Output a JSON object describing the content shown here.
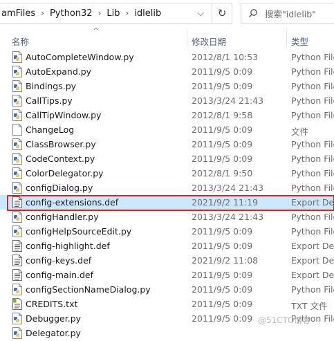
{
  "address": {
    "crumbs": [
      "amFiles",
      "Python32",
      "Lib",
      "idlelib"
    ],
    "separator": "›",
    "dropdown_icon": "chevron-down-icon",
    "refresh_icon": "refresh-icon"
  },
  "search": {
    "placeholder": "搜索\"idlelib\"",
    "icon": "search-icon"
  },
  "columns": {
    "name": "名称",
    "date": "修改日期",
    "type": "类型"
  },
  "files": [
    {
      "name": "AutoCompleteWindow.py",
      "date": "2012/8/1 10:53",
      "type": "Python File",
      "icon": "python-file-icon"
    },
    {
      "name": "AutoExpand.py",
      "date": "2011/9/5 0:09",
      "type": "Python File",
      "icon": "python-file-icon"
    },
    {
      "name": "Bindings.py",
      "date": "2011/9/5 0:09",
      "type": "Python File",
      "icon": "python-file-icon"
    },
    {
      "name": "CallTips.py",
      "date": "2013/3/24 21:43",
      "type": "Python File",
      "icon": "python-file-icon"
    },
    {
      "name": "CallTipWindow.py",
      "date": "2012/8/1 9:58",
      "type": "Python File",
      "icon": "python-file-icon"
    },
    {
      "name": "ChangeLog",
      "date": "2011/9/5 0:09",
      "type": "文件",
      "icon": "blank-file-icon"
    },
    {
      "name": "ClassBrowser.py",
      "date": "2011/9/5 0:09",
      "type": "Python File",
      "icon": "python-file-icon"
    },
    {
      "name": "CodeContext.py",
      "date": "2011/9/5 0:09",
      "type": "Python File",
      "icon": "python-file-icon"
    },
    {
      "name": "ColorDelegator.py",
      "date": "2012/8/1 9:50",
      "type": "Python File",
      "icon": "python-file-icon"
    },
    {
      "name": "configDialog.py",
      "date": "2013/3/24 21:43",
      "type": "Python File",
      "icon": "python-file-icon"
    },
    {
      "name": "config-extensions.def",
      "date": "2021/9/2 11:19",
      "type": "Export Def",
      "icon": "def-file-icon",
      "selected": true
    },
    {
      "name": "configHandler.py",
      "date": "2013/3/24 21:43",
      "type": "Python File",
      "icon": "python-file-icon"
    },
    {
      "name": "configHelpSourceEdit.py",
      "date": "2011/9/5 0:09",
      "type": "Python File",
      "icon": "python-file-icon"
    },
    {
      "name": "config-highlight.def",
      "date": "2011/9/5 0:09",
      "type": "Export Def",
      "icon": "def-file-icon"
    },
    {
      "name": "config-keys.def",
      "date": "2021/9/2 11:08",
      "type": "Export Def",
      "icon": "def-file-icon"
    },
    {
      "name": "config-main.def",
      "date": "2011/9/5 0:09",
      "type": "Export Def",
      "icon": "def-file-icon"
    },
    {
      "name": "configSectionNameDialog.py",
      "date": "2011/9/5 0:09",
      "type": "Python File",
      "icon": "python-file-icon"
    },
    {
      "name": "CREDITS.txt",
      "date": "2011/9/5 0:09",
      "type": "TXT 文件",
      "icon": "text-file-icon"
    },
    {
      "name": "Debugger.py",
      "date": "2011/9/5 0:09",
      "type": "Python File",
      "icon": "python-file-icon"
    },
    {
      "name": "Delegator.py",
      "date": "",
      "type": "",
      "icon": "python-file-icon"
    }
  ],
  "watermark": "@51CTO博客",
  "colors": {
    "selection": "#cce8ff",
    "highlight_border": "#e02020",
    "header_text": "#4c607a"
  }
}
